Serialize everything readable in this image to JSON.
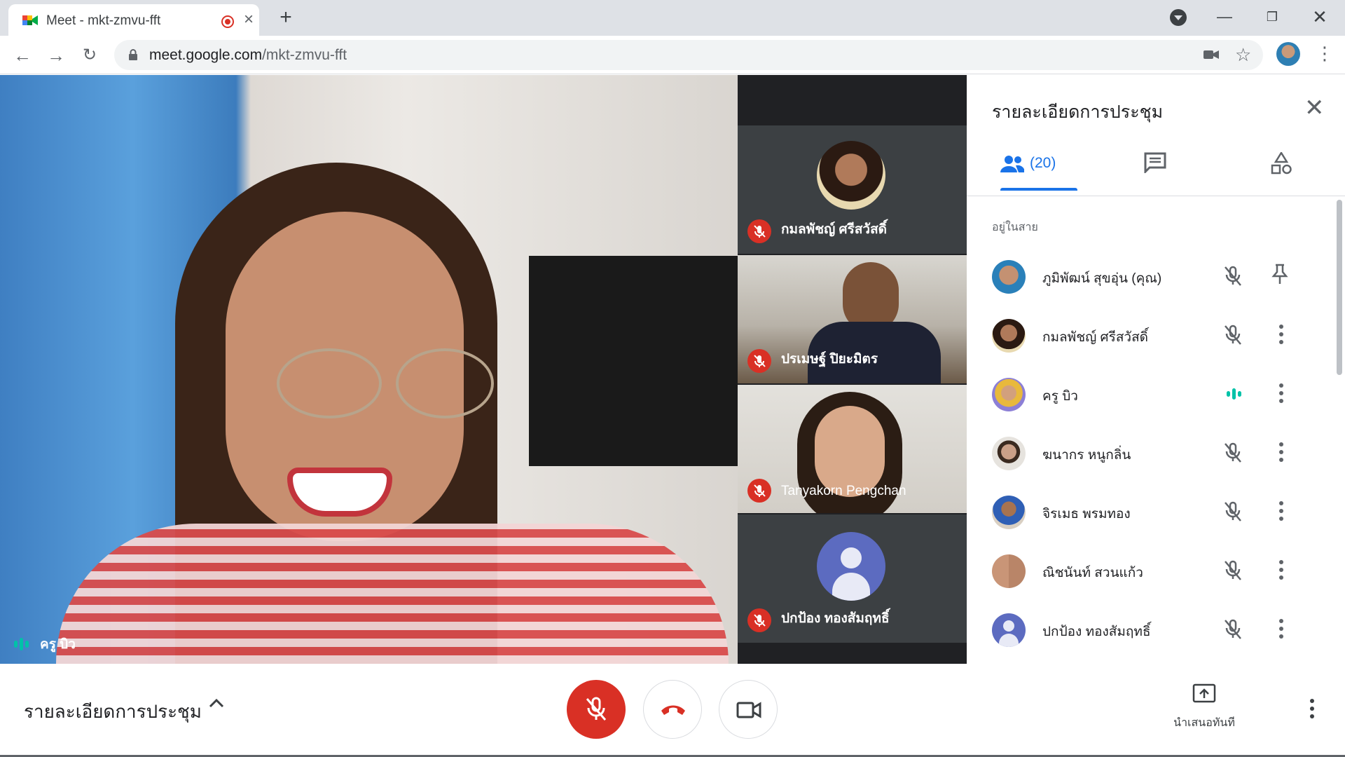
{
  "browser": {
    "tab_title": "Meet - mkt-zmvu-fft",
    "url_host": "meet.google.com",
    "url_path": "/mkt-zmvu-fft"
  },
  "stage": {
    "main_speaker": "ครู บิว",
    "tiles": [
      {
        "name": "กมลพัชญ์ ศรีสวัสดิ์",
        "muted": true
      },
      {
        "name": "ปรเมษฐ์ ปิยะมิตร",
        "muted": true
      },
      {
        "name": "Tanyakorn Pengchan",
        "muted": true
      },
      {
        "name": "ปกป้อง ทองสัมฤทธิ์",
        "muted": true
      }
    ]
  },
  "panel": {
    "title": "รายละเอียดการประชุม",
    "people_count": "(20)",
    "section_label": "อยู่ในสาย",
    "participants": [
      {
        "name": "ภูมิพัฒน์ สุขอุ่น (คุณ)",
        "mic": "muted",
        "action": "pin"
      },
      {
        "name": "กมลพัชญ์ ศรีสวัสดิ์",
        "mic": "muted",
        "action": "more"
      },
      {
        "name": "ครู บิว",
        "mic": "speaking",
        "action": "more"
      },
      {
        "name": "ฆนากร หนูกลิ่น",
        "mic": "muted",
        "action": "more"
      },
      {
        "name": "จิรเมธ พรมทอง",
        "mic": "muted",
        "action": "more"
      },
      {
        "name": "ณิชนันท์ สวนแก้ว",
        "mic": "muted",
        "action": "more"
      },
      {
        "name": "ปกป้อง ทองสัมฤทธิ์",
        "mic": "muted",
        "action": "more"
      }
    ]
  },
  "bottom": {
    "meeting_details": "รายละเอียดการประชุม",
    "present_label": "นำเสนอทันที"
  },
  "colors": {
    "accent": "#1a73e8",
    "danger": "#d93025",
    "speaking": "#00c2a8"
  }
}
